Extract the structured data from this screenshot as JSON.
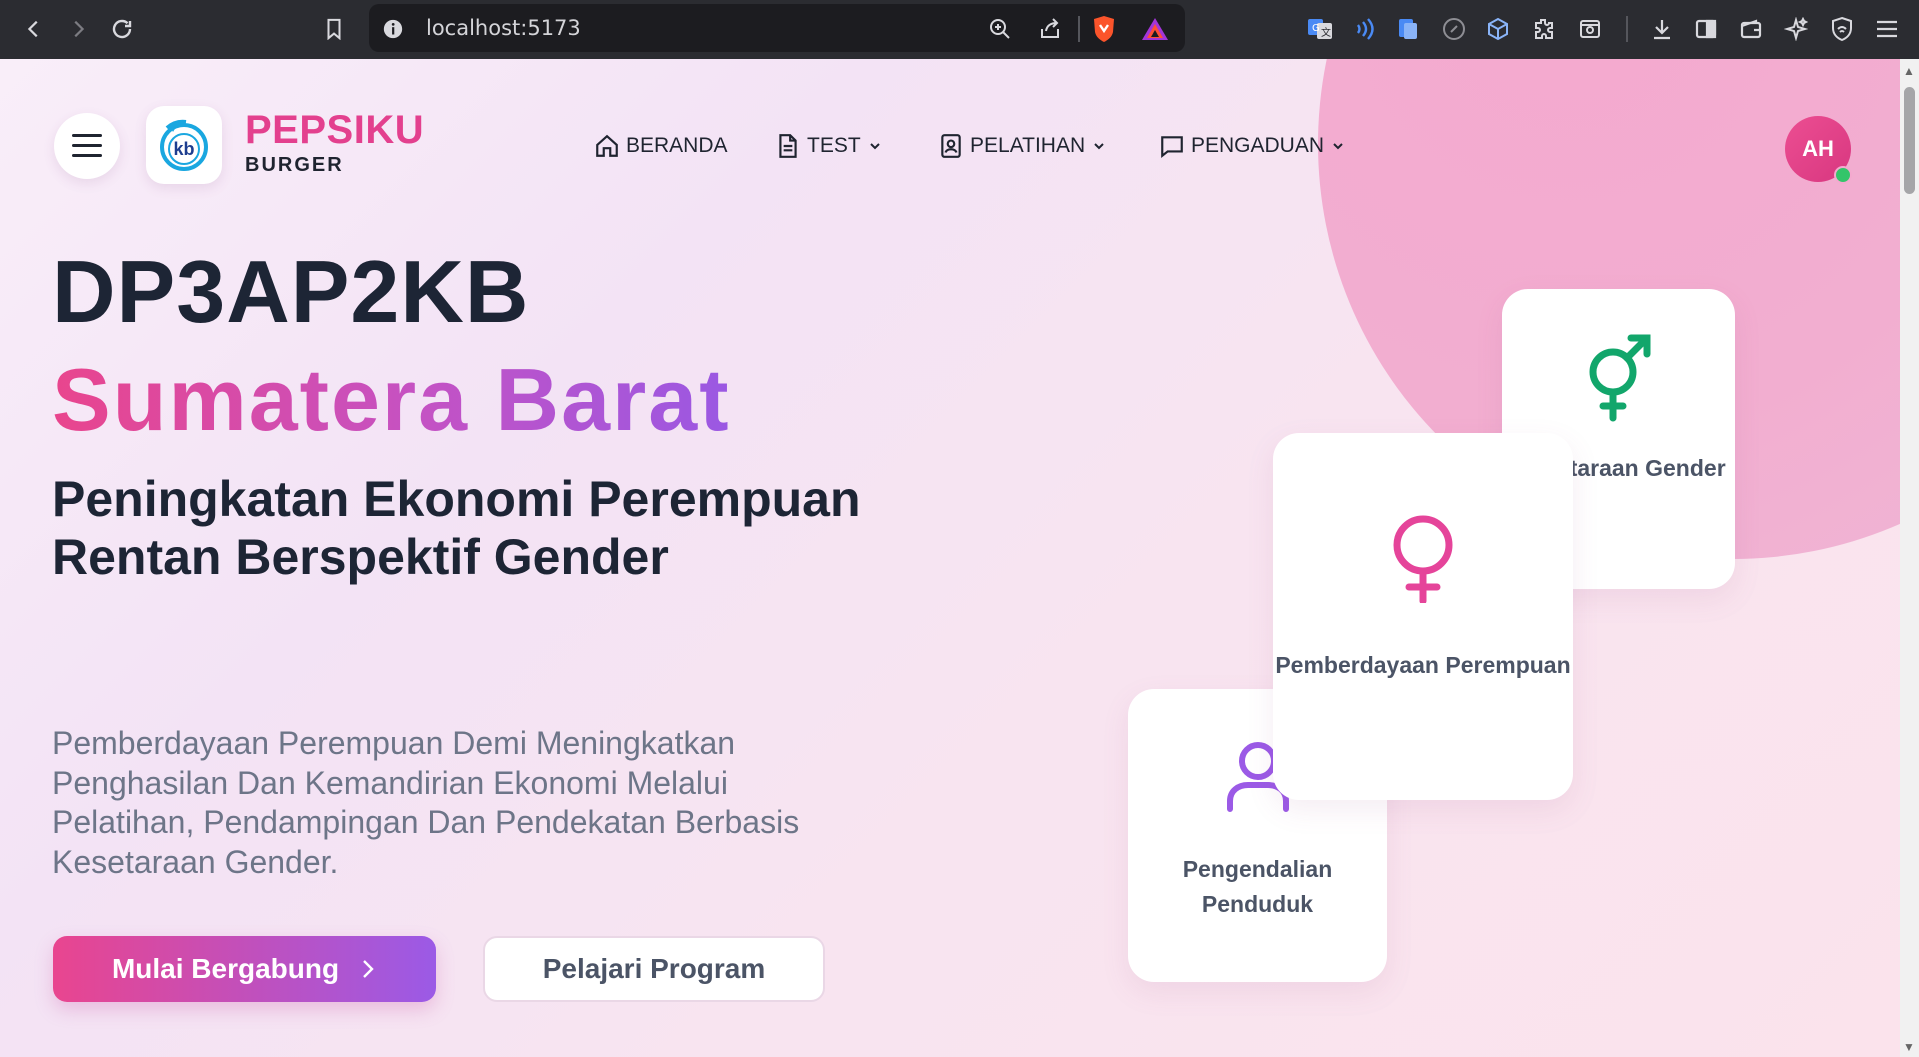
{
  "browser": {
    "url": "localhost:5173"
  },
  "header": {
    "brand": "PEPSIKU",
    "brand_sub": "BURGER",
    "logo_text": "kb",
    "nav": [
      {
        "label": "BERANDA",
        "icon": "home-icon",
        "has_dropdown": false
      },
      {
        "label": "TEST",
        "icon": "document-icon",
        "has_dropdown": true
      },
      {
        "label": "PELATIHAN",
        "icon": "contact-book-icon",
        "has_dropdown": true
      },
      {
        "label": "PENGADUAN",
        "icon": "chat-icon",
        "has_dropdown": true
      }
    ],
    "avatar_initials": "AH"
  },
  "hero": {
    "title": "DP3AP2KB",
    "title_accent": "Sumatera Barat",
    "subtitle": "Peningkatan Ekonomi Perempuan Rentan Berspektif Gender",
    "description": "Pemberdayaan Perempuan Demi Meningkatkan Penghasilan Dan Kemandirian Ekonomi Melalui Pelatihan, Pendampingan Dan Pendekatan Berbasis Kesetaraan Gender.",
    "primary_button": "Mulai Bergabung",
    "secondary_button": "Pelajari Program"
  },
  "cards": {
    "gender": {
      "label": "esetaraan Gender",
      "icon": "gender-symbol-icon",
      "color": "#12a66b"
    },
    "women": {
      "label": "Pemberdayaan Perempuan",
      "icon": "female-symbol-icon",
      "color": "#e5449a"
    },
    "population": {
      "label": "Pengendalian Penduduk",
      "icon": "user-icon",
      "color": "#9b5ae6"
    }
  },
  "colors": {
    "brand": "#e3408e",
    "gradient_start": "#e9458f",
    "gradient_end": "#9b5ae6",
    "dark_text": "#1d2535",
    "online": "#34c56a"
  }
}
